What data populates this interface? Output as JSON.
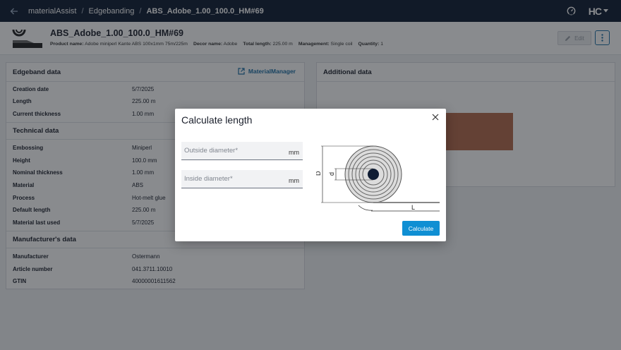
{
  "topbar": {
    "breadcrumbs": [
      "materialAssist",
      "Edgebanding",
      "ABS_Adobe_1.00_100.0_HM#69"
    ],
    "separator": "/",
    "logo_text": "HC"
  },
  "header": {
    "title": "ABS_Adobe_1.00_100.0_HM#69",
    "meta": [
      {
        "key": "Product name:",
        "value": "Adobe miniperl Kante ABS 100x1mm 75m/225m"
      },
      {
        "key": "Decor name:",
        "value": "Adobe"
      },
      {
        "key": "Total length:",
        "value": "225.00 m"
      },
      {
        "key": "Management:",
        "value": "Single coil"
      },
      {
        "key": "Quantity:",
        "value": "1"
      }
    ],
    "edit_label": "Edit"
  },
  "edgeband": {
    "title": "Edgeband data",
    "material_manager_label": "MaterialManager",
    "rows": [
      {
        "key": "Creation date",
        "value": "5/7/2025"
      },
      {
        "key": "Length",
        "value": "225.00 m"
      },
      {
        "key": "Current thickness",
        "value": "1.00 mm"
      }
    ],
    "technical_title": "Technical data",
    "technical_rows": [
      {
        "key": "Embossing",
        "value": "Miniperl"
      },
      {
        "key": "Height",
        "value": "100.0 mm"
      },
      {
        "key": "Nominal thickness",
        "value": "1.00 mm"
      },
      {
        "key": "Material",
        "value": "ABS"
      },
      {
        "key": "Process",
        "value": "Hot-melt glue"
      },
      {
        "key": "Default length",
        "value": "225.00 m"
      },
      {
        "key": "Material last used",
        "value": "5/7/2025"
      }
    ],
    "manufacturer_title": "Manufacturer's data",
    "manufacturer_rows": [
      {
        "key": "Manufacturer",
        "value": "Ostermann"
      },
      {
        "key": "Article number",
        "value": "041.3711.10010"
      },
      {
        "key": "GTIN",
        "value": "40000001611562"
      }
    ]
  },
  "additional": {
    "title": "Additional data",
    "swatch_color": "#b46a4c"
  },
  "dialog": {
    "title": "Calculate length",
    "outside": {
      "placeholder": "Outside diameter*",
      "unit": "mm",
      "value": ""
    },
    "inside": {
      "placeholder": "Inside diameter*",
      "unit": "mm",
      "value": ""
    },
    "diagram_labels": {
      "outer": "D",
      "inner": "d",
      "length": "L"
    },
    "calculate_label": "Calculate"
  },
  "colors": {
    "topbar": "#0f1c33",
    "accent": "#0f8fd3",
    "link": "#1d6fa5"
  }
}
